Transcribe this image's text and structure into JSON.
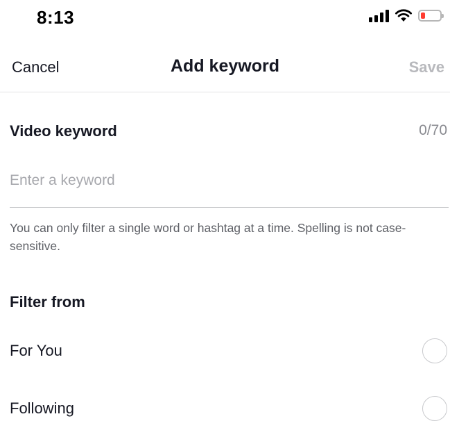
{
  "status_bar": {
    "time": "8:13",
    "icons": [
      "signal-icon",
      "wifi-icon",
      "battery-low-icon"
    ],
    "battery_color": "#ff3b30"
  },
  "nav": {
    "cancel_label": "Cancel",
    "title": "Add keyword",
    "save_label": "Save"
  },
  "keyword": {
    "section_label": "Video keyword",
    "counter": "0/70",
    "placeholder": "Enter a keyword",
    "value": "",
    "helper_text": "You can only filter a single word or hashtag at a time. Spelling is not case-sensitive."
  },
  "filter": {
    "section_label": "Filter from",
    "options": [
      {
        "label": "For You",
        "selected": false
      },
      {
        "label": "Following",
        "selected": false
      }
    ]
  },
  "colors": {
    "text_primary": "#161823",
    "text_disabled": "#b8b9bd",
    "placeholder": "#a7a8ad",
    "divider": "#e3e3e4"
  }
}
